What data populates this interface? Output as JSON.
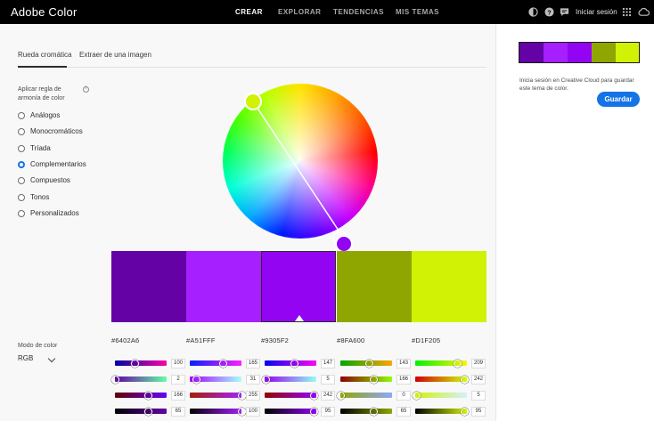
{
  "header": {
    "brand": "Adobe Color",
    "nav": [
      {
        "label": "CREAR",
        "active": true
      },
      {
        "label": "EXPLORAR",
        "active": false
      },
      {
        "label": "TENDENCIAS",
        "active": false
      },
      {
        "label": "MIS TEMAS",
        "active": false
      }
    ],
    "icons": [
      "contrast-icon",
      "help-icon",
      "comment-icon"
    ],
    "signin_label": "Iniciar sesión",
    "apps_icon": "apps-grid-icon",
    "creative_cloud_icon": "creative-cloud-icon"
  },
  "tabs": [
    {
      "label": "Rueda cromática",
      "active": true
    },
    {
      "label": "Extraer de una imagen",
      "active": false
    }
  ],
  "rules": {
    "label": "Aplicar regla de armonía de color",
    "info_icon": "info-icon",
    "options": [
      {
        "label": "Análogos",
        "checked": false
      },
      {
        "label": "Monocromáticos",
        "checked": false
      },
      {
        "label": "Tríada",
        "checked": false
      },
      {
        "label": "Complementarios",
        "checked": true
      },
      {
        "label": "Compuestos",
        "checked": false
      },
      {
        "label": "Tonos",
        "checked": false
      },
      {
        "label": "Personalizados",
        "checked": false
      }
    ]
  },
  "color_mode": {
    "label": "Modo de color",
    "value": "RGB"
  },
  "swatches": [
    {
      "hex": "#6402A6",
      "color": "#6402a6",
      "r": 100,
      "g": 2,
      "b": 166,
      "selected": false
    },
    {
      "hex": "#A51FFF",
      "color": "#a51fff",
      "r": 165,
      "g": 31,
      "b": 255,
      "selected": false
    },
    {
      "hex": "#9305F2",
      "color": "#9305f2",
      "r": 147,
      "g": 5,
      "b": 242,
      "selected": true
    },
    {
      "hex": "#8FA600",
      "color": "#8fa600",
      "r": 143,
      "g": 166,
      "b": 0,
      "selected": false
    },
    {
      "hex": "#D1F205",
      "color": "#d1f205",
      "r": 209,
      "g": 242,
      "b": 5,
      "selected": false
    }
  ],
  "slider_values": [
    [
      "100",
      "2",
      "166",
      "65"
    ],
    [
      "165",
      "31",
      "255",
      "100"
    ],
    [
      "147",
      "5",
      "242",
      "95"
    ],
    [
      "143",
      "166",
      "0",
      "65"
    ],
    [
      "209",
      "242",
      "5",
      "95"
    ]
  ],
  "sidebar": {
    "message": "Inicia sesión en Creative Cloud para guardar este tema de color.",
    "save_label": "Guardar"
  }
}
